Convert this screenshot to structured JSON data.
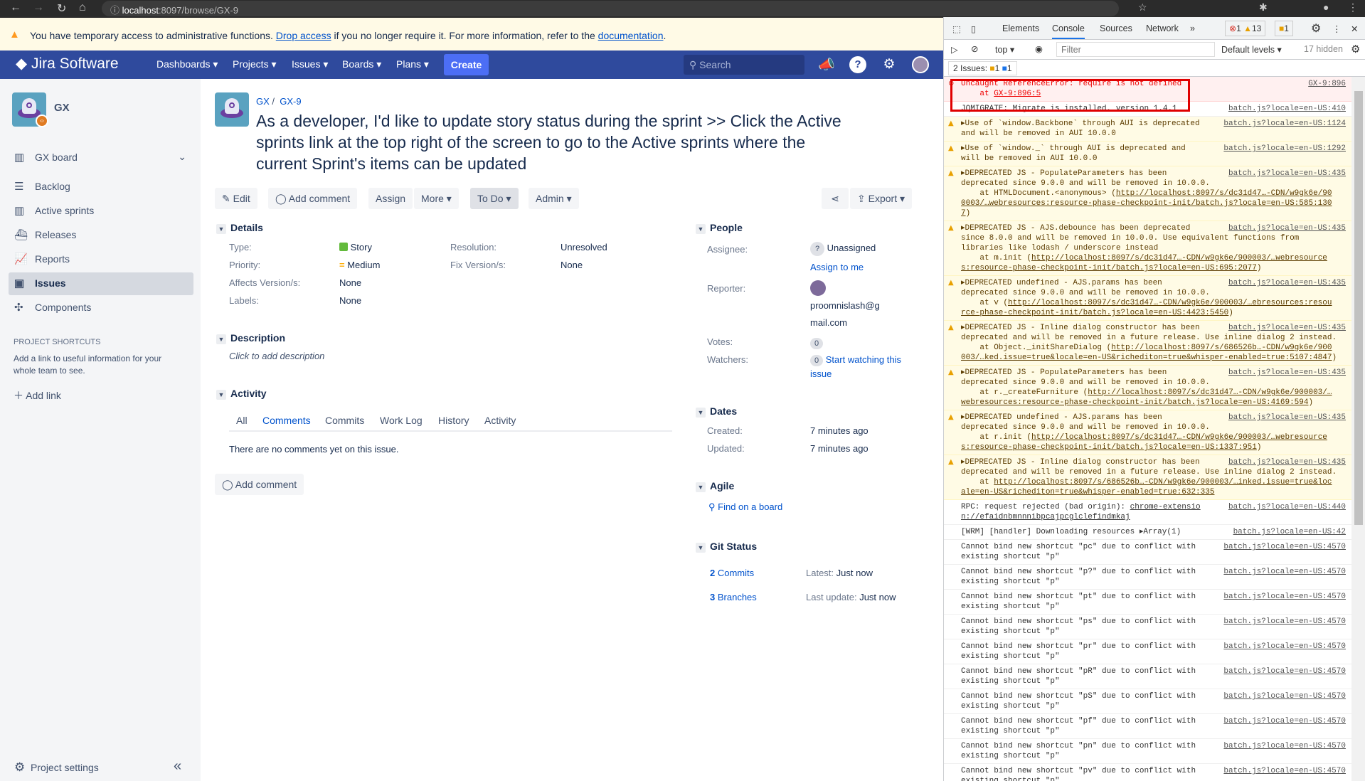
{
  "browser": {
    "url_host": "localhost",
    "url_path": ":8097/browse/GX-9"
  },
  "banner": {
    "text1": "You have temporary access to administrative functions. ",
    "link1": "Drop access",
    "text2": " if you no longer require it. For more information, refer to the ",
    "link2": "documentation",
    "text3": "."
  },
  "nav": {
    "logo": "Jira Software",
    "items": [
      "Dashboards",
      "Projects",
      "Issues",
      "Boards",
      "Plans"
    ],
    "create": "Create",
    "search_placeholder": "Search"
  },
  "sidebar": {
    "project_name": "GX",
    "board": "GX board",
    "items": [
      "Backlog",
      "Active sprints",
      "Releases",
      "Reports",
      "Issues",
      "Components"
    ],
    "shortcuts_heading": "PROJECT SHORTCUTS",
    "shortcuts_text": "Add a link to useful information for your whole team to see.",
    "add_link": "Add link",
    "settings": "Project settings"
  },
  "issue": {
    "breadcrumb": [
      "GX",
      "GX-9"
    ],
    "title": "As a developer, I'd like to update story status during the sprint >> Click the Active sprints link at the top right of the screen to go to the Active sprints where the current Sprint's items can be updated",
    "toolbar": {
      "edit": "Edit",
      "add_comment": "Add comment",
      "assign": "Assign",
      "more": "More",
      "status": "To Do",
      "admin": "Admin",
      "export": "Export"
    },
    "details": {
      "heading": "Details",
      "type_label": "Type:",
      "type": "Story",
      "priority_label": "Priority:",
      "priority": "Medium",
      "affects_label": "Affects Version/s:",
      "affects": "None",
      "labels_label": "Labels:",
      "labels": "None",
      "resolution_label": "Resolution:",
      "resolution": "Unresolved",
      "fix_label": "Fix Version/s:",
      "fix": "None"
    },
    "description": {
      "heading": "Description",
      "placeholder": "Click to add description"
    },
    "activity": {
      "heading": "Activity",
      "tabs": [
        "All",
        "Comments",
        "Commits",
        "Work Log",
        "History",
        "Activity"
      ],
      "active_tab": "Comments",
      "empty": "There are no comments yet on this issue.",
      "add_comment": "Add comment"
    },
    "people": {
      "heading": "People",
      "assignee_label": "Assignee:",
      "assignee": "Unassigned",
      "assign_to_me": "Assign to me",
      "reporter_label": "Reporter:",
      "reporter_line1": "proomnislash@g",
      "reporter_line2": "mail.com",
      "votes_label": "Votes:",
      "votes": "0",
      "watchers_label": "Watchers:",
      "watchers": "0",
      "watch_link1": "Start watching this",
      "watch_link2": "issue"
    },
    "dates": {
      "heading": "Dates",
      "created_label": "Created:",
      "created": "7 minutes ago",
      "updated_label": "Updated:",
      "updated": "7 minutes ago"
    },
    "agile": {
      "heading": "Agile",
      "find": "Find on a board"
    },
    "git": {
      "heading": "Git Status",
      "commits_n": "2",
      "commits": "Commits",
      "latest_label": "Latest:",
      "latest": "Just now",
      "branches_n": "3",
      "branches": "Branches",
      "last_update_label": "Last update:",
      "last_update": "Just now"
    }
  },
  "devtools": {
    "tabs": [
      "Elements",
      "Console",
      "Sources",
      "Network"
    ],
    "active_tab": "Console",
    "more_tabs": "»",
    "errors": "1",
    "warnings": "13",
    "issues_badge": "1",
    "context": "top",
    "filter_placeholder": "Filter",
    "levels": "Default levels",
    "hidden": "17 hidden",
    "issues_label": "2 Issues:",
    "issues_warn": "1",
    "issues_info": "1",
    "messages": [
      {
        "level": "error",
        "source": "GX-9:896",
        "lines": [
          [
            {
              "t": "Uncaught ReferenceError: require is not defined"
            }
          ],
          [
            {
              "t": "    at "
            },
            {
              "u": "GX-9:896:5"
            }
          ]
        ]
      },
      {
        "level": "info",
        "source": "batch.js?locale=en-US:410",
        "lines": [
          [
            {
              "t": "JQMIGRATE: Migrate is installed, version 1.4.1"
            }
          ]
        ]
      },
      {
        "level": "warn",
        "source": "batch.js?locale=en-US:1124",
        "lines": [
          [
            {
              "t": "▸Use of `window.Backbone` through AUI is deprecated"
            }
          ],
          [
            {
              "t": "and will be removed in AUI 10.0.0"
            }
          ]
        ]
      },
      {
        "level": "warn",
        "source": "batch.js?locale=en-US:1292",
        "lines": [
          [
            {
              "t": "▸Use of `window._` through AUI is deprecated and"
            }
          ],
          [
            {
              "t": "will be removed in AUI 10.0.0"
            }
          ]
        ]
      },
      {
        "level": "warn",
        "source": "batch.js?locale=en-US:435",
        "lines": [
          [
            {
              "t": "▸DEPRECATED JS - PopulateParameters has been"
            }
          ],
          [
            {
              "t": "deprecated since 9.0.0 and will be removed in 10.0.0."
            }
          ],
          [
            {
              "t": "    at HTMLDocument.<anonymous> ("
            },
            {
              "u": "http://localhost:8097/s/dc31d47…-CDN/w9gk6e/90"
            }
          ],
          [
            {
              "u": "0003/…webresources:resource-phase-checkpoint-init/batch.js?locale=en-US:585:130"
            }
          ],
          [
            {
              "u": "7"
            },
            {
              "t": ")"
            }
          ]
        ]
      },
      {
        "level": "warn",
        "source": "batch.js?locale=en-US:435",
        "lines": [
          [
            {
              "t": "▸DEPRECATED JS - AJS.debounce has been deprecated"
            }
          ],
          [
            {
              "t": "since 8.0.0 and will be removed in 10.0.0. Use equivalent functions from"
            }
          ],
          [
            {
              "t": "libraries like lodash / underscore instead"
            }
          ],
          [
            {
              "t": "    at m.init ("
            },
            {
              "u": "http://localhost:8097/s/dc31d47…-CDN/w9gk6e/900003/…webresource"
            }
          ],
          [
            {
              "u": "s:resource-phase-checkpoint-init/batch.js?locale=en-US:695:2077"
            },
            {
              "t": ")"
            }
          ]
        ]
      },
      {
        "level": "warn",
        "source": "batch.js?locale=en-US:435",
        "lines": [
          [
            {
              "t": "▸DEPRECATED undefined - AJS.params has been"
            }
          ],
          [
            {
              "t": "deprecated since 9.0.0 and will be removed in 10.0.0."
            }
          ],
          [
            {
              "t": "    at v ("
            },
            {
              "u": "http://localhost:8097/s/dc31d47…-CDN/w9gk6e/900003/…ebresources:resou"
            }
          ],
          [
            {
              "u": "rce-phase-checkpoint-init/batch.js?locale=en-US:4423:5450"
            },
            {
              "t": ")"
            }
          ]
        ]
      },
      {
        "level": "warn",
        "source": "batch.js?locale=en-US:435",
        "lines": [
          [
            {
              "t": "▸DEPRECATED JS - Inline dialog constructor has been"
            }
          ],
          [
            {
              "t": "deprecated and will be removed in a future release. Use inline dialog 2 instead."
            }
          ],
          [
            {
              "t": "    at Object._initShareDialog ("
            },
            {
              "u": "http://localhost:8097/s/686526b…-CDN/w9gk6e/900"
            }
          ],
          [
            {
              "u": "003/…ked.issue=true&locale=en-US&richediton=true&whisper-enabled=true:5107:4847"
            },
            {
              "t": ")"
            }
          ]
        ]
      },
      {
        "level": "warn",
        "source": "batch.js?locale=en-US:435",
        "lines": [
          [
            {
              "t": "▸DEPRECATED JS - PopulateParameters has been"
            }
          ],
          [
            {
              "t": "deprecated since 9.0.0 and will be removed in 10.0.0."
            }
          ],
          [
            {
              "t": "    at r._createFurniture ("
            },
            {
              "u": "http://localhost:8097/s/dc31d47…-CDN/w9gk6e/900003/…"
            }
          ],
          [
            {
              "u": "webresources:resource-phase-checkpoint-init/batch.js?locale=en-US:4169:594"
            },
            {
              "t": ")"
            }
          ]
        ]
      },
      {
        "level": "warn",
        "source": "batch.js?locale=en-US:435",
        "lines": [
          [
            {
              "t": "▸DEPRECATED undefined - AJS.params has been"
            }
          ],
          [
            {
              "t": "deprecated since 9.0.0 and will be removed in 10.0.0."
            }
          ],
          [
            {
              "t": "    at r.init ("
            },
            {
              "u": "http://localhost:8097/s/dc31d47…-CDN/w9gk6e/900003/…webresource"
            }
          ],
          [
            {
              "u": "s:resource-phase-checkpoint-init/batch.js?locale=en-US:1337:951"
            },
            {
              "t": ")"
            }
          ]
        ]
      },
      {
        "level": "warn",
        "source": "batch.js?locale=en-US:435",
        "lines": [
          [
            {
              "t": "▸DEPRECATED JS - Inline dialog constructor has been"
            }
          ],
          [
            {
              "t": "deprecated and will be removed in a future release. Use inline dialog 2 instead."
            }
          ],
          [
            {
              "t": "    at "
            },
            {
              "u": "http://localhost:8097/s/686526b…-CDN/w9gk6e/900003/…inked.issue=true&loc"
            }
          ],
          [
            {
              "u": "ale=en-US&richediton=true&whisper-enabled=true:632:335"
            }
          ]
        ]
      },
      {
        "level": "info",
        "source": "batch.js?locale=en-US:440",
        "lines": [
          [
            {
              "t": "RPC: request rejected (bad origin): "
            },
            {
              "u": "chrome-extensio"
            }
          ],
          [
            {
              "u": "n://efaidnbmnnnibpcajpcglclefindmkaj"
            }
          ]
        ]
      },
      {
        "level": "info",
        "source": "batch.js?locale=en-US:42",
        "lines": [
          [
            {
              "t": "[WRM] [handler] Downloading resources ▸Array(1)"
            }
          ]
        ]
      },
      {
        "level": "info",
        "source": "batch.js?locale=en-US:4570",
        "lines": [
          [
            {
              "t": "Cannot bind new shortcut \"pc\" due to conflict with"
            }
          ],
          [
            {
              "t": "existing shortcut \"p\""
            }
          ]
        ]
      },
      {
        "level": "info",
        "source": "batch.js?locale=en-US:4570",
        "lines": [
          [
            {
              "t": "Cannot bind new shortcut \"p?\" due to conflict with"
            }
          ],
          [
            {
              "t": "existing shortcut \"p\""
            }
          ]
        ]
      },
      {
        "level": "info",
        "source": "batch.js?locale=en-US:4570",
        "lines": [
          [
            {
              "t": "Cannot bind new shortcut \"pt\" due to conflict with"
            }
          ],
          [
            {
              "t": "existing shortcut \"p\""
            }
          ]
        ]
      },
      {
        "level": "info",
        "source": "batch.js?locale=en-US:4570",
        "lines": [
          [
            {
              "t": "Cannot bind new shortcut \"ps\" due to conflict with"
            }
          ],
          [
            {
              "t": "existing shortcut \"p\""
            }
          ]
        ]
      },
      {
        "level": "info",
        "source": "batch.js?locale=en-US:4570",
        "lines": [
          [
            {
              "t": "Cannot bind new shortcut \"pr\" due to conflict with"
            }
          ],
          [
            {
              "t": "existing shortcut \"p\""
            }
          ]
        ]
      },
      {
        "level": "info",
        "source": "batch.js?locale=en-US:4570",
        "lines": [
          [
            {
              "t": "Cannot bind new shortcut \"pR\" due to conflict with"
            }
          ],
          [
            {
              "t": "existing shortcut \"p\""
            }
          ]
        ]
      },
      {
        "level": "info",
        "source": "batch.js?locale=en-US:4570",
        "lines": [
          [
            {
              "t": "Cannot bind new shortcut \"pS\" due to conflict with"
            }
          ],
          [
            {
              "t": "existing shortcut \"p\""
            }
          ]
        ]
      },
      {
        "level": "info",
        "source": "batch.js?locale=en-US:4570",
        "lines": [
          [
            {
              "t": "Cannot bind new shortcut \"pf\" due to conflict with"
            }
          ],
          [
            {
              "t": "existing shortcut \"p\""
            }
          ]
        ]
      },
      {
        "level": "info",
        "source": "batch.js?locale=en-US:4570",
        "lines": [
          [
            {
              "t": "Cannot bind new shortcut \"pn\" due to conflict with"
            }
          ],
          [
            {
              "t": "existing shortcut \"p\""
            }
          ]
        ]
      },
      {
        "level": "info",
        "source": "batch.js?locale=en-US:4570",
        "lines": [
          [
            {
              "t": "Cannot bind new shortcut \"pv\" due to conflict with"
            }
          ],
          [
            {
              "t": "existing shortcut \"p\""
            }
          ]
        ]
      }
    ]
  },
  "colors": {
    "nav": "#2f4a9d",
    "create": "#4c6ef5",
    "link": "#0052cc",
    "error": "#e00000",
    "warn_bg": "#fffbe5"
  }
}
